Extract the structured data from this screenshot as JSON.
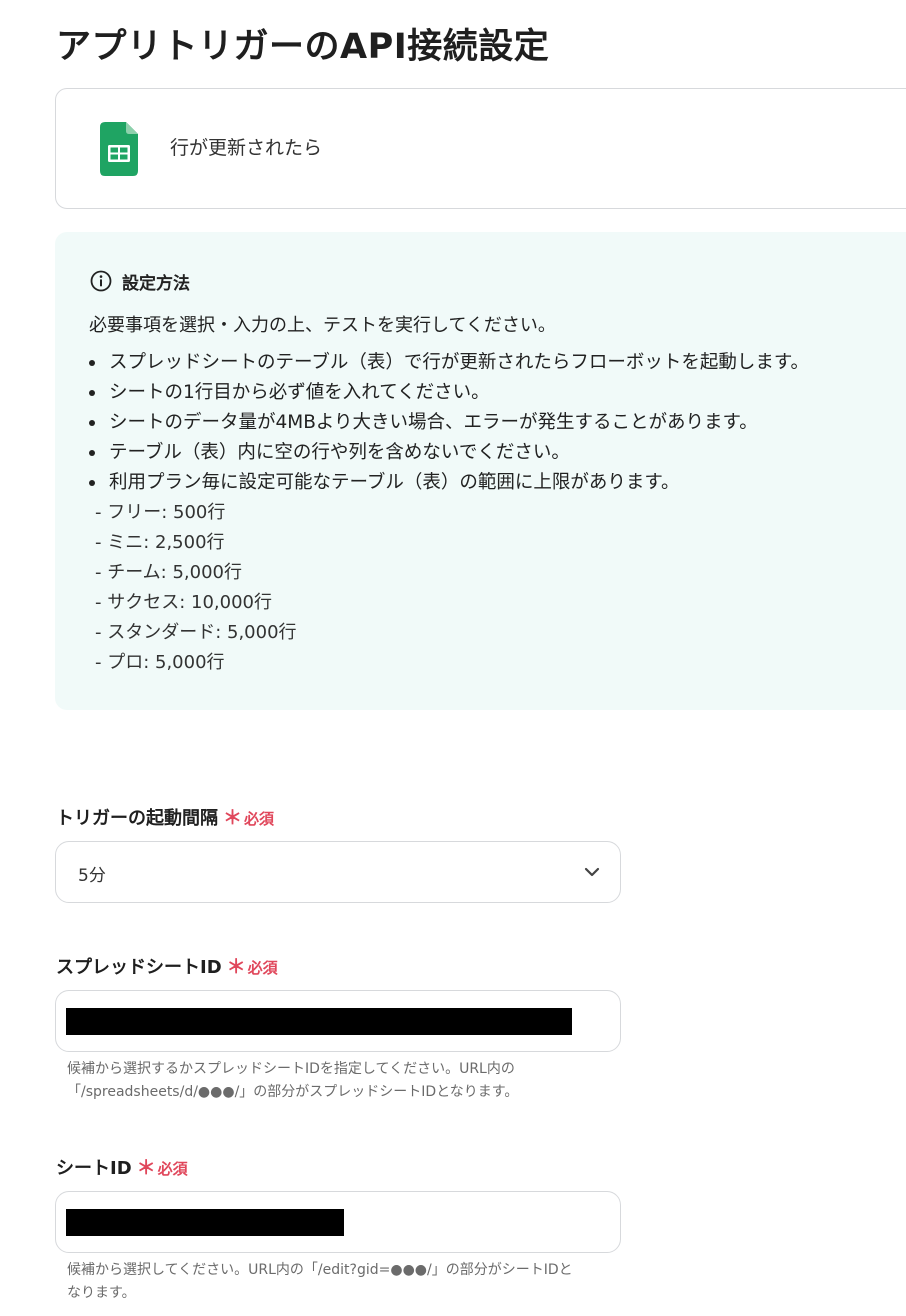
{
  "page_title": "アプリトリガーのAPI接続設定",
  "trigger": {
    "icon": "google-sheets-icon",
    "name": "行が更新されたら"
  },
  "info": {
    "icon": "info-icon",
    "title": "設定方法",
    "intro": "必要事項を選択・入力の上、テストを実行してください。",
    "bullets": [
      "スプレッドシートのテーブル（表）で行が更新されたらフローボットを起動します。",
      "シートの1行目から必ず値を入れてください。",
      "シートのデータ量が4MBより大きい場合、エラーが発生することがあります。",
      "テーブル（表）内に空の行や列を含めないでください。",
      "利用プラン毎に設定可能なテーブル（表）の範囲に上限があります。"
    ],
    "plans": [
      "- フリー: 500行",
      "- ミニ: 2,500行",
      "- チーム: 5,000行",
      "- サクセス: 10,000行",
      "- スタンダード: 5,000行",
      "- プロ: 5,000行"
    ]
  },
  "required": {
    "star": "＊",
    "label": "必須"
  },
  "fields": {
    "interval": {
      "label": "トリガーの起動間隔",
      "value": "5分"
    },
    "spreadsheet_id": {
      "label": "スプレッドシートID",
      "help_line1": "候補から選択するかスプレッドシートIDを指定してください。URL内の",
      "help_line2": "「/spreadsheets/d/●●●/」の部分がスプレッドシートIDとなります。"
    },
    "sheet_id": {
      "label": "シートID",
      "help_line1": "候補から選択してください。URL内の「/edit?gid=●●●/」の部分がシートIDと",
      "help_line2": "なります。"
    }
  },
  "colors": {
    "required": "#e0475b",
    "info_background": "#f1faf9",
    "sheets_green": "#1fa463"
  }
}
